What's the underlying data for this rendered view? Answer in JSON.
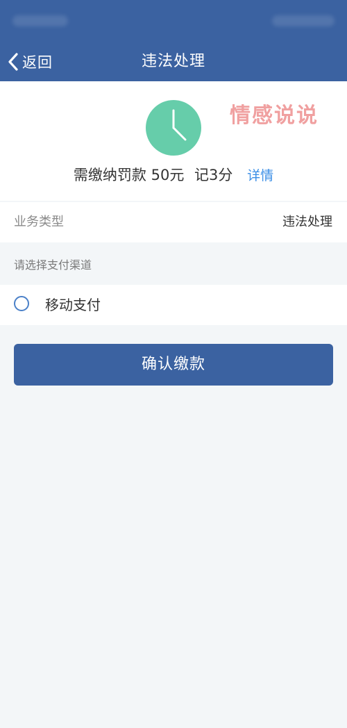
{
  "header": {
    "back_label": "返回",
    "title": "违法处理",
    "background_color": "#3b62a1"
  },
  "summary": {
    "status_icon": "clock-icon",
    "icon_color": "#66cdaa",
    "fine_text": "需缴纳罚款",
    "fine_amount": "50元",
    "points_text": "记3分",
    "details_link": "详情",
    "watermark": "情感说说"
  },
  "business": {
    "label": "业务类型",
    "value": "违法处理"
  },
  "payment": {
    "section_label": "请选择支付渠道",
    "options": [
      {
        "label": "移动支付",
        "selected": false
      }
    ]
  },
  "confirm_button": {
    "label": "确认缴款"
  }
}
